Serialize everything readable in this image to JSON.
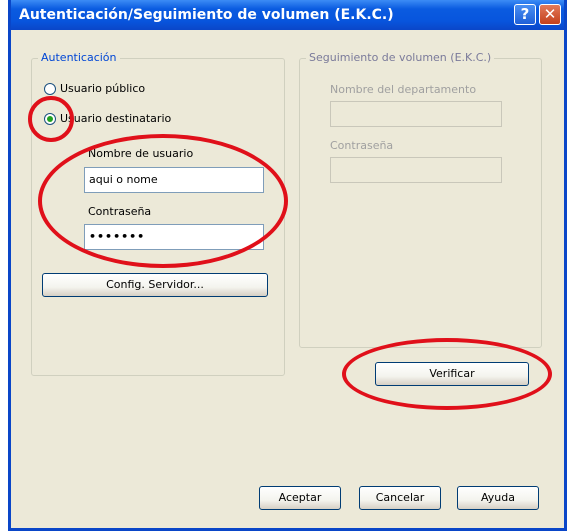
{
  "window": {
    "title": "Autenticación/Seguimiento de volumen (E.K.C.)",
    "help_button": "?",
    "close_button": "✕"
  },
  "auth_group": {
    "legend": "Autenticación",
    "radio_public": "Usuario público",
    "radio_recipient": "Usuario destinatario",
    "selected": "Usuario destinatario",
    "username_label": "Nombre de usuario",
    "username_value": "aqui o nome",
    "password_label": "Contraseña",
    "password_value": "•••••••",
    "config_button": "Config. Servidor..."
  },
  "volume_group": {
    "legend": "Seguimiento de volumen (E.K.C.)",
    "dept_label": "Nombre del departamento",
    "dept_value": "",
    "password_label": "Contraseña",
    "password_value": "",
    "verify_button": "Verificar"
  },
  "footer": {
    "accept_button": "Aceptar",
    "cancel_button": "Cancelar",
    "help_button": "Ayuda"
  },
  "annotation_color": "#e0101a",
  "icons": [
    "help-icon",
    "close-icon"
  ]
}
